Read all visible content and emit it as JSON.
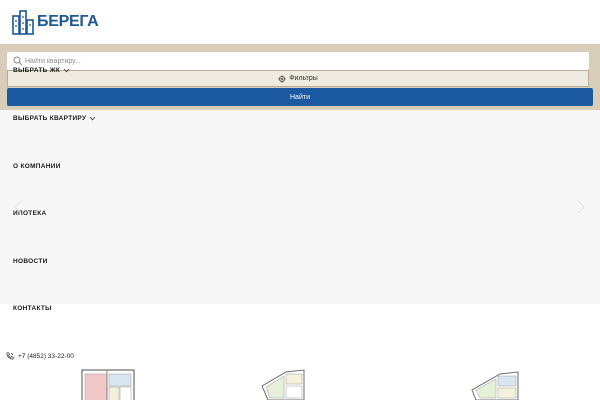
{
  "brand": {
    "logo_text": "БЕРЕГА",
    "color": "#1f5a96"
  },
  "search": {
    "placeholder": "Найти квартиру...",
    "complex_select_label": "ВЫБРАТЬ ЖК",
    "filters_label": "Фильтры",
    "submit_label": "Найти",
    "submit_color": "#1b5aa0",
    "panel_color": "#d8cdb9"
  },
  "nav": {
    "items": [
      {
        "label": "ВЫБРАТЬ КВАРТИРУ"
      },
      {
        "label": "О КОМПАНИИ"
      },
      {
        "label": "ИПОТЕКА"
      },
      {
        "label": "НОВОСТИ"
      },
      {
        "label": "КОНТАКТЫ"
      }
    ]
  },
  "contact": {
    "phone": "+7 (4852) 33-22-00"
  },
  "icons": {
    "logo": "building-logo-icon",
    "search": "search-icon",
    "filters": "gear-icon",
    "phone": "phone-icon",
    "chevron": "chevron-down-icon",
    "prev": "chevron-left-icon",
    "next": "chevron-right-icon"
  }
}
